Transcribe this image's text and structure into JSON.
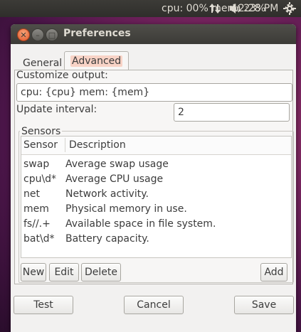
{
  "panel": {
    "indicator_text": "cpu: 00% mem: 23%",
    "network_icon": "up-down-arrows-icon",
    "volume_icon": "speaker-icon",
    "clock": "12:28 PM",
    "settings_icon": "gear-icon"
  },
  "window": {
    "title": "Preferences",
    "close_icon": "close-icon",
    "minimize_icon": "minimize-icon",
    "maximize_icon": "maximize-icon"
  },
  "tabs": [
    {
      "label": "General",
      "active": false
    },
    {
      "label": "Advanced",
      "active": true
    }
  ],
  "advanced": {
    "customize_label": "Customize output:",
    "customize_value": "cpu: {cpu} mem: {mem}",
    "interval_label": "Update interval:",
    "interval_value": "2",
    "sensors_label": "Sensors",
    "columns": [
      "Sensor",
      "Description"
    ],
    "rows": [
      {
        "sensor": "swap",
        "description": "Average swap usage"
      },
      {
        "sensor": "cpu\\d*",
        "description": "Average CPU usage"
      },
      {
        "sensor": "net",
        "description": "Network activity."
      },
      {
        "sensor": "mem",
        "description": "Physical memory in use."
      },
      {
        "sensor": "fs//.+",
        "description": "Available space in file system."
      },
      {
        "sensor": "bat\\d*",
        "description": "Battery capacity."
      }
    ],
    "buttons": {
      "new": "New",
      "edit": "Edit",
      "delete": "Delete",
      "add": "Add"
    }
  },
  "footer": {
    "test": "Test",
    "cancel": "Cancel",
    "save": "Save"
  },
  "colors": {
    "panel": "#3c3b37",
    "window_bg": "#f2f1f0",
    "close_button": "#e0562a",
    "tab_highlight": "#f8d3c6"
  }
}
